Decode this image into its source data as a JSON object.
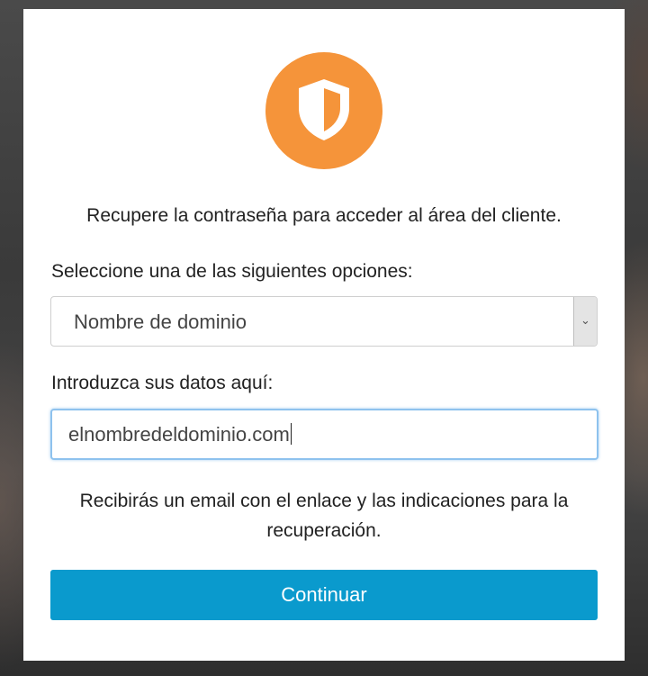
{
  "intro": "Recupere la contraseña para acceder al área del cliente.",
  "select": {
    "label": "Seleccione una de las siguientes opciones:",
    "value": "Nombre de dominio"
  },
  "input": {
    "label": "Introduzca sus datos aquí:",
    "value": "elnombredeldominio.com"
  },
  "note": "Recibirás un email con el enlace y las indicaciones para la recuperación.",
  "continue_label": "Continuar",
  "icons": {
    "logo": "shield-icon",
    "select_arrow": "chevron-down-icon"
  },
  "colors": {
    "logo": "#f5943a",
    "button": "#0a9acd",
    "focus": "#8ec2ee"
  }
}
